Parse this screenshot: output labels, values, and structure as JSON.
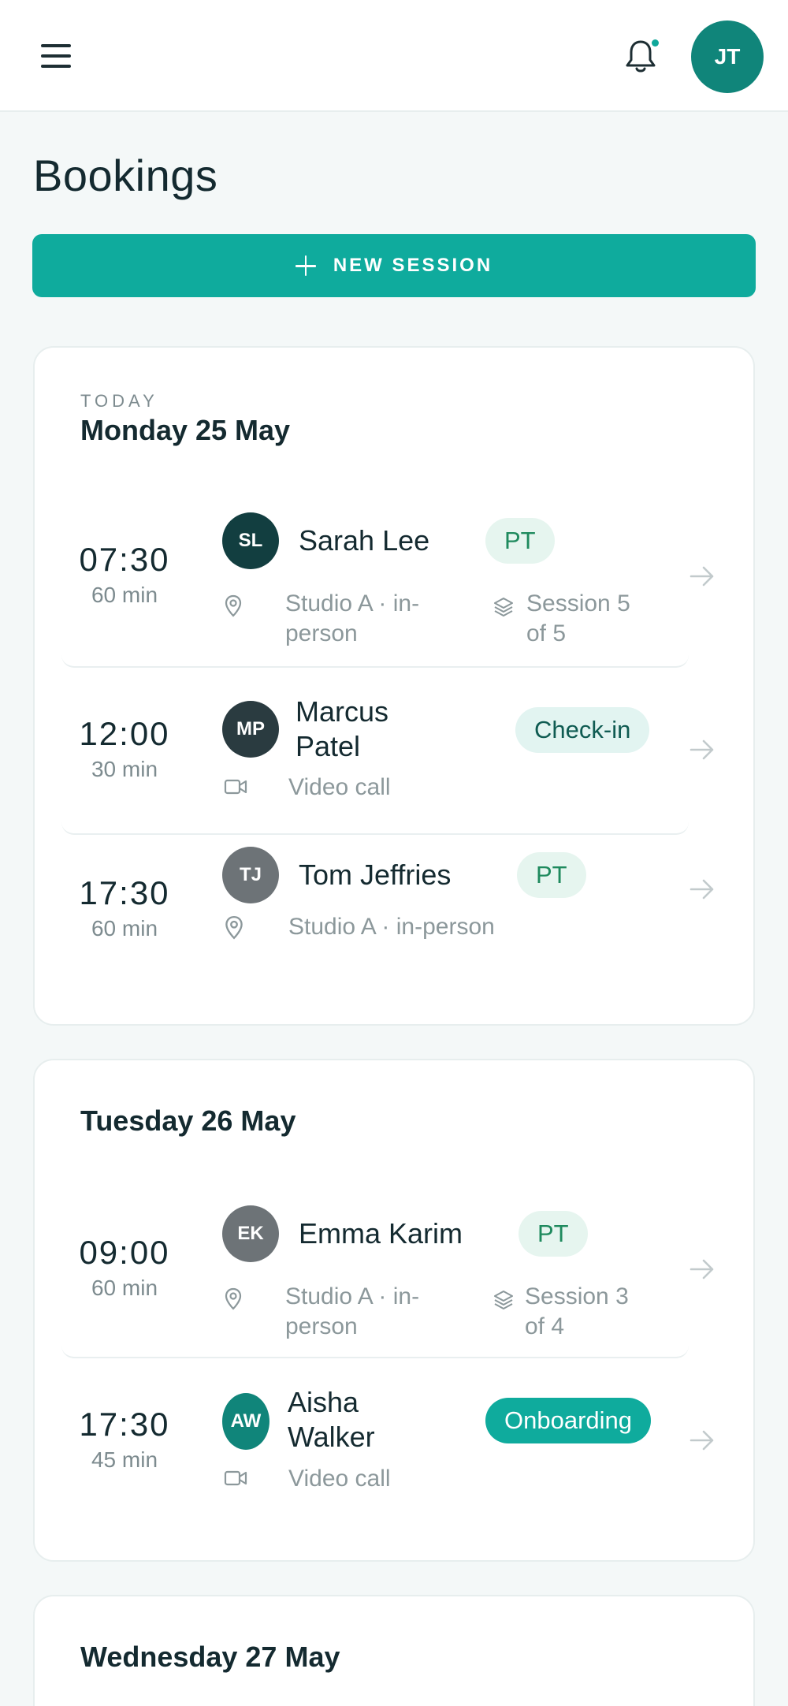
{
  "header": {
    "avatar_initials": "JT"
  },
  "page": {
    "title": "Bookings",
    "new_session_label": "NEW SESSION"
  },
  "days": [
    {
      "eyebrow": "TODAY",
      "title": "Monday 25 May",
      "bookings": [
        {
          "time": "07:30",
          "duration": "60 min",
          "initials": "SL",
          "avatar_color": "#123e40",
          "name": "Sarah Lee",
          "badge": "PT",
          "location": "Studio A · in-person",
          "location_line1": "Studio A · in-",
          "location_line2": "person",
          "session_line1": "Session 5",
          "session_line2": "of 5"
        },
        {
          "time": "12:00",
          "duration": "30 min",
          "initials": "MP",
          "avatar_color": "#2a3b40",
          "name_line1": "Marcus",
          "name_line2": "Patel",
          "badge": "Check-in",
          "location": "Video call"
        },
        {
          "time": "17:30",
          "duration": "60 min",
          "initials": "TJ",
          "avatar_color": "#6d7377",
          "name": "Tom Jeffries",
          "badge": "PT",
          "location": "Studio A · in-person"
        }
      ]
    },
    {
      "title": "Tuesday 26 May",
      "bookings": [
        {
          "time": "09:00",
          "duration": "60 min",
          "initials": "EK",
          "avatar_color": "#6d7377",
          "name": "Emma Karim",
          "badge": "PT",
          "location_line1": "Studio A · in-",
          "location_line2": "person",
          "session_line1": "Session 3",
          "session_line2": "of 4"
        },
        {
          "time": "17:30",
          "duration": "45 min",
          "initials": "AW",
          "avatar_color": "#10857a",
          "name_line1": "Aisha",
          "name_line2": "Walker",
          "badge": "Onboarding",
          "location": "Video call"
        }
      ]
    },
    {
      "title": "Wednesday 27 May"
    }
  ],
  "icons": {
    "menu": "menu-icon",
    "bell": "bell-icon",
    "plus": "plus-icon",
    "location": "map-pin-icon",
    "session": "layers-icon",
    "video": "video-camera-icon",
    "arrow": "arrow-right-icon"
  },
  "colors": {
    "accent": "#0fab9d",
    "dark_teal": "#10857a",
    "text": "#142a30",
    "muted": "#8c989b",
    "badge_soft_bg": "#e6f5ef",
    "badge_soft_text": "#1f8a5e"
  }
}
